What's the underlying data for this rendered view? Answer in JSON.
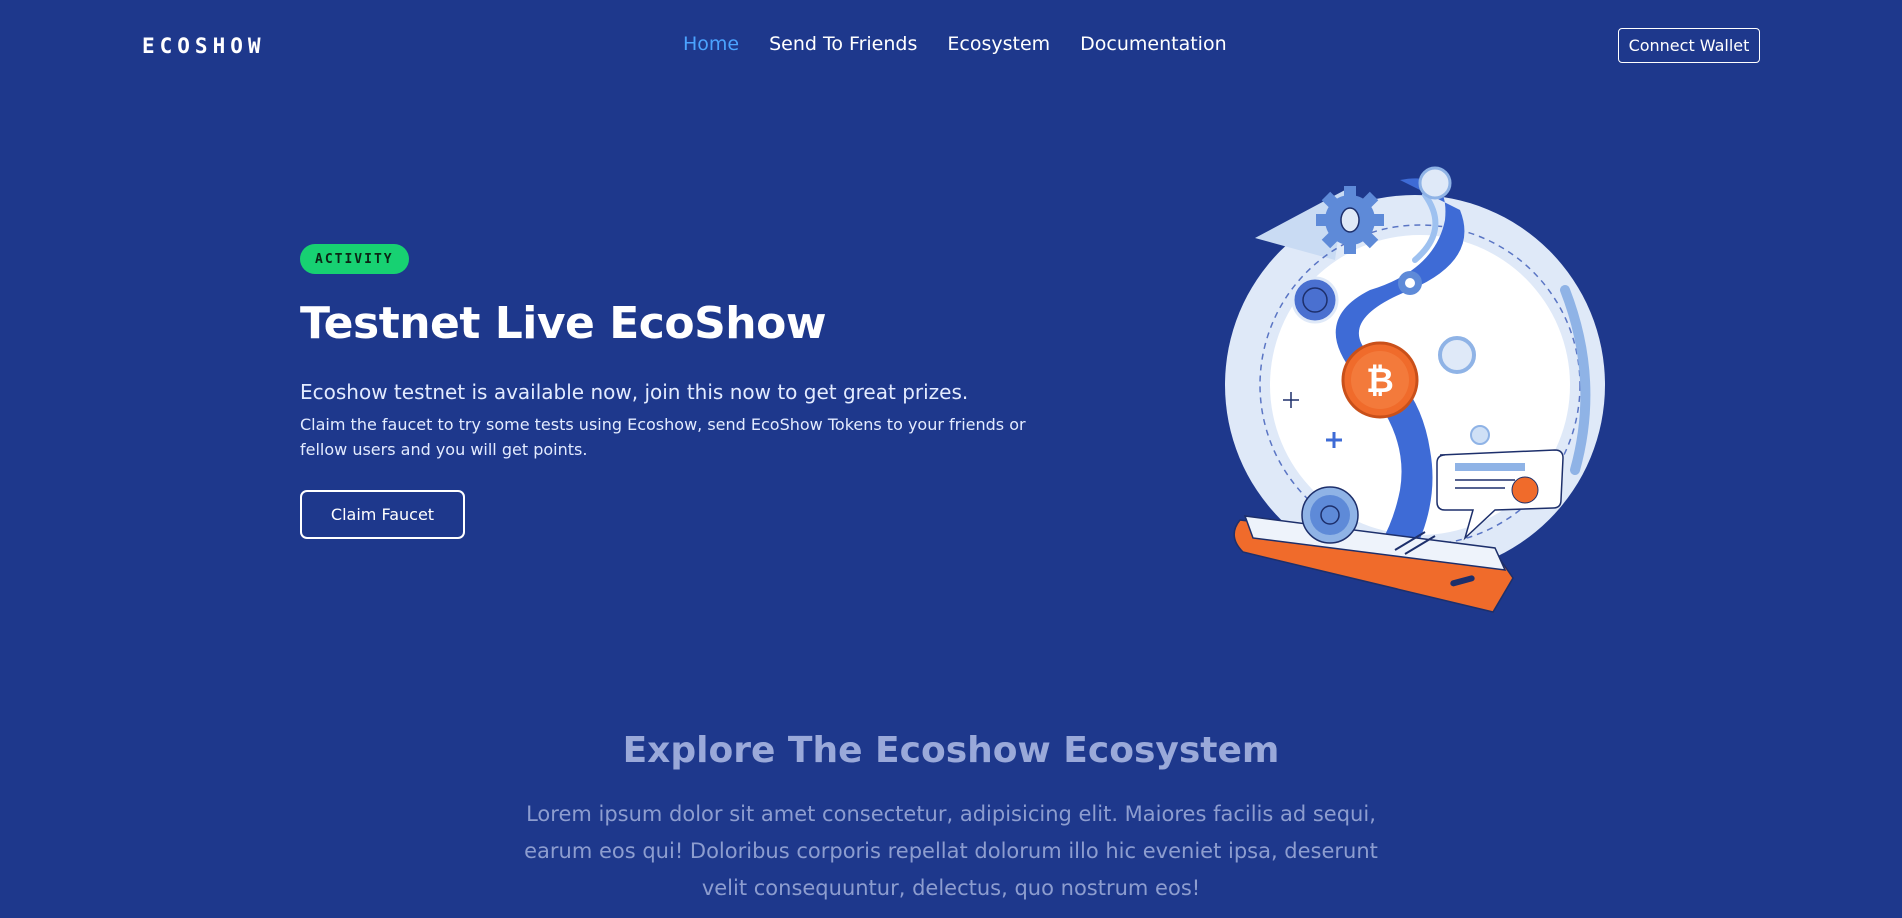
{
  "header": {
    "logo": "ECOSHOW",
    "nav": [
      {
        "label": "Home",
        "active": true
      },
      {
        "label": "Send To Friends",
        "active": false
      },
      {
        "label": "Ecosystem",
        "active": false
      },
      {
        "label": "Documentation",
        "active": false
      }
    ],
    "connect_label": "Connect Wallet"
  },
  "hero": {
    "badge": "ACTIVITY",
    "title": "Testnet Live EcoShow",
    "subtitle": "Ecoshow testnet is available now, join this now to get great prizes.",
    "description": "Claim the faucet to try some tests using Ecoshow, send EcoShow Tokens to your friends or fellow users and you will get points.",
    "button_label": "Claim Faucet",
    "illustration_icons": [
      "bitcoin-coin-icon",
      "gear-icon",
      "phone-icon",
      "chat-bubble-icon"
    ]
  },
  "explore": {
    "title": "Explore The Ecoshow Ecosystem",
    "text": "Lorem ipsum dolor sit amet consectetur, adipisicing elit. Maiores facilis ad sequi, earum eos qui! Doloribus corporis repellat dolorum illo hic eveniet ipsa, deserunt velit consequuntur, delectus, quo nostrum eos!"
  },
  "colors": {
    "background": "#1e388c",
    "nav_active": "#4ba3ff",
    "badge": "#17d172",
    "bitcoin": "#f06b2b"
  }
}
